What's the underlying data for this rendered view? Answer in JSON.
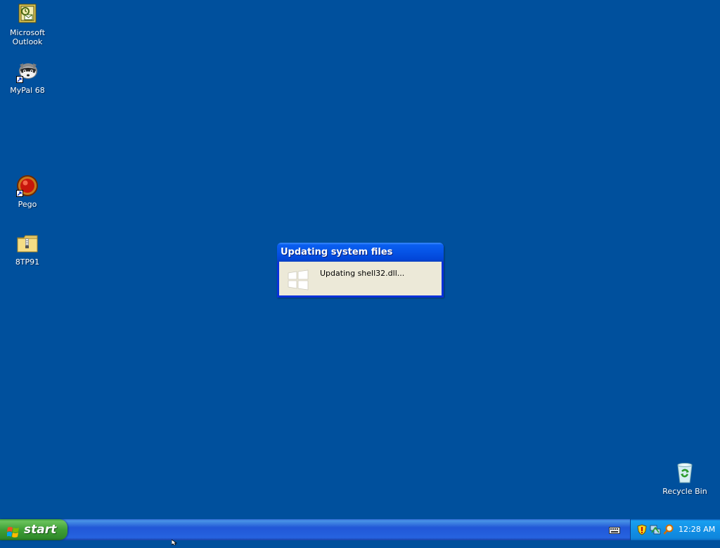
{
  "desktop": {
    "background_color": "#00509d",
    "icons": [
      {
        "label": "Microsoft Outlook",
        "icon": "outlook-icon"
      },
      {
        "label": "MyPal 68",
        "icon": "mypal-icon"
      },
      {
        "label": "Pego",
        "icon": "pego-icon"
      },
      {
        "label": "8TP91",
        "icon": "zip-folder-icon"
      },
      {
        "label": "Recycle Bin",
        "icon": "recycle-bin-icon"
      }
    ]
  },
  "dialog": {
    "title": "Updating system files",
    "message": "Updating shell32.dll...",
    "icon": "windows-logo-icon"
  },
  "taskbar": {
    "start_label": "start",
    "clock": "12:28 AM",
    "tray_icons": [
      "security-shield-icon",
      "network-icon",
      "search-icon"
    ],
    "language_icon": "keyboard-icon"
  }
}
